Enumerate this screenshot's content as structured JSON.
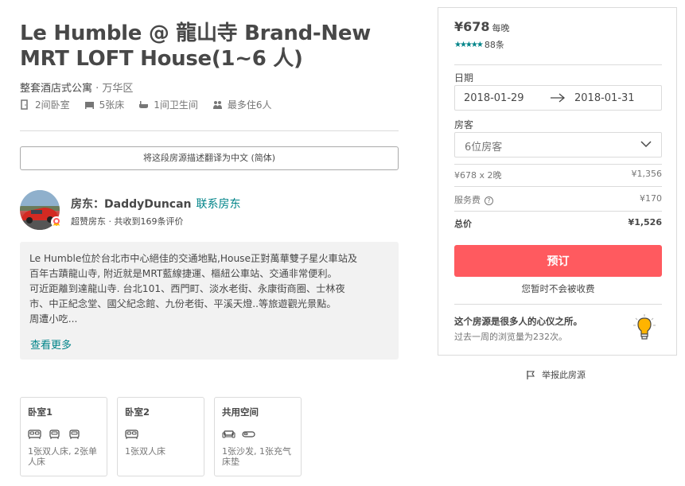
{
  "listing": {
    "title": "Le Humble @ 龍山寺 Brand-New MRT LOFT House(1~6 人)",
    "type": "整套酒店式公寓",
    "sep": " · ",
    "location": "万华区",
    "amenities": [
      {
        "icon": "door-icon",
        "label": "2间卧室"
      },
      {
        "icon": "bed-icon",
        "label": "5张床"
      },
      {
        "icon": "bath-icon",
        "label": "1间卫生间"
      },
      {
        "icon": "guests-icon",
        "label": "最多住6人"
      }
    ],
    "translate_label": "将这段房源描述翻译为中文 (简体)"
  },
  "host": {
    "prefix": "房东：",
    "name": "DaddyDuncan",
    "contact": "联系房东",
    "summary": "超赞房东 · 共收到169条评价"
  },
  "description": {
    "text": "Le Humble位於台北市中心絕佳的交通地點,House正對萬華雙子星火車站及\n百年古蹟龍山寺, 附近就是MRT藍線捷運、樞紐公車站、交通非常便利。\n可近距離到達龍山寺. 台北101、西門町、淡水老街、永康街商圈、士林夜\n市、中正紀念堂、國父紀念館、九份老街、平溪天燈..等旅遊觀光景點。\n周遭小吃...",
    "read_more": "查看更多"
  },
  "rooms": [
    {
      "title": "卧室1",
      "icons": [
        "double-bed-icon",
        "single-bed-icon",
        "single-bed-icon"
      ],
      "desc": "1张双人床, 2张单人床"
    },
    {
      "title": "卧室2",
      "icons": [
        "double-bed-icon"
      ],
      "desc": "1张双人床"
    },
    {
      "title": "共用空间",
      "icons": [
        "sofa-icon",
        "air-mattress-icon"
      ],
      "desc": "1张沙发, 1张充气床垫"
    }
  ],
  "booking": {
    "price": "¥678",
    "per_night": "每晚",
    "rating_stars": 5,
    "review_count": "88条",
    "dates_label": "日期",
    "checkin": "2018-01-29",
    "checkout": "2018-01-31",
    "guests_label": "房客",
    "guests_value": "6位房客",
    "nightly_calc": "¥678 x 2晚",
    "nightly_total": "¥1,356",
    "service_fee_label": "服务费",
    "service_fee": "¥170",
    "total_label": "总价",
    "total": "¥1,526",
    "book_button": "预订",
    "no_charge": "您暂时不会被收费",
    "popular_title": "这个房源是很多人的心仪之所。",
    "popular_sub": "过去一周的浏览量为232次。"
  },
  "report_label": "举报此房源",
  "colors": {
    "accent": "#008489",
    "book": "#ff5a5f",
    "text": "#484848",
    "muted": "#767676"
  }
}
